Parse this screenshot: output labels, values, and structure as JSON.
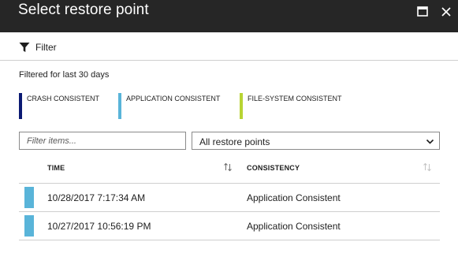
{
  "window": {
    "title": "Select restore point",
    "controls": [
      "maximize-icon",
      "close-icon"
    ]
  },
  "commandbar": {
    "filter_label": "Filter",
    "filter_icon": "funnel-icon"
  },
  "filter_note": "Filtered for last 30 days",
  "legend": [
    {
      "label": "CRASH CONSISTENT",
      "color": "#0b1a73"
    },
    {
      "label": "APPLICATION CONSISTENT",
      "color": "#59b4d9"
    },
    {
      "label": "FILE-SYSTEM CONSISTENT",
      "color": "#b8d433"
    }
  ],
  "search": {
    "placeholder": "Filter items...",
    "value": ""
  },
  "restore_filter": {
    "selected": "All restore points",
    "icon": "chevron-down-icon"
  },
  "table": {
    "columns": [
      {
        "label": "TIME",
        "sort_icon": "sort-updown-icon"
      },
      {
        "label": "CONSISTENCY",
        "sort_icon": "sort-updown-icon"
      }
    ],
    "rows": [
      {
        "time": "10/28/2017 7:17:34 AM",
        "consistency": "Application Consistent",
        "color": "#59b4d9"
      },
      {
        "time": "10/27/2017 10:56:19 PM",
        "consistency": "Application Consistent",
        "color": "#59b4d9"
      }
    ]
  }
}
